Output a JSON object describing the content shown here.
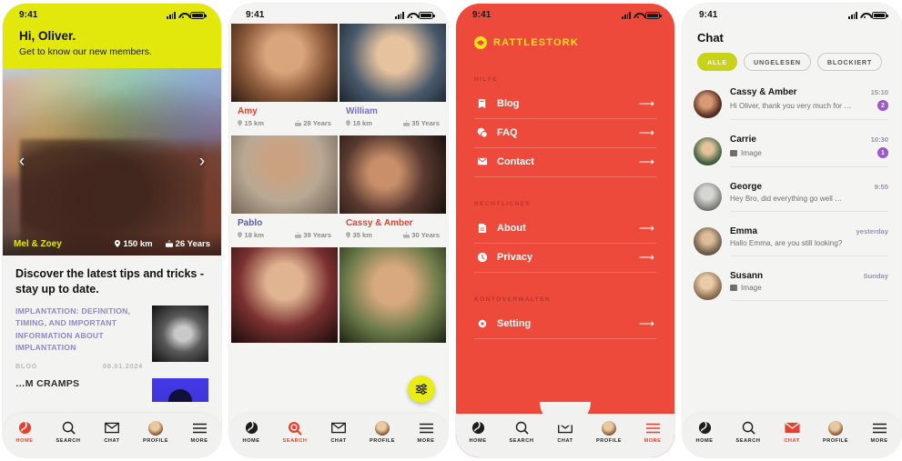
{
  "status_bar": {
    "time": "9:41"
  },
  "nav": {
    "items": [
      {
        "label": "HOME",
        "icon": "globe-icon"
      },
      {
        "label": "SEARCH",
        "icon": "search-icon"
      },
      {
        "label": "CHAT",
        "icon": "envelope-icon"
      },
      {
        "label": "PROFILE",
        "icon": "avatar-icon"
      },
      {
        "label": "MORE",
        "icon": "hamburger-icon"
      }
    ]
  },
  "colors": {
    "brand_red": "#ee4a3c",
    "brand_yellow": "#e3e80c",
    "accent_olive": "#c9d21a",
    "badge_purple": "#9b59c7",
    "blog_purple": "#8f86c9"
  },
  "phone1": {
    "greeting": "Hi, Oliver.",
    "subtitle": "Get to know our new members.",
    "hero": {
      "name": "Mel & Zoey",
      "distance": "150 km",
      "age": "26 Years"
    },
    "carousel": {
      "prev": "‹",
      "next": "›"
    },
    "section_title": "Discover the latest tips and tricks - stay up to date.",
    "blog": {
      "headline": "IMPLANTATION: DEFINITION, TIMING, AND IMPORTANT INFORMATION ABOUT IMPLANTATION",
      "category": "BLOG",
      "date": "08.01.2024"
    },
    "next_article": {
      "headline": "…M CRAMPS"
    },
    "active_nav": "HOME"
  },
  "phone2": {
    "members": [
      {
        "name": "Amy",
        "distance": "15 km",
        "age": "28 Years",
        "name_color": "#e8402f"
      },
      {
        "name": "William",
        "distance": "18 km",
        "age": "35 Years",
        "name_color": "#7a6fc4"
      },
      {
        "name": "Pablo",
        "distance": "18 km",
        "age": "39 Years",
        "name_color": "#5b5ab0"
      },
      {
        "name": "Cassy & Amber",
        "distance": "35 km",
        "age": "30 Years",
        "name_color": "#e8402f"
      }
    ],
    "filter_button": "filter-sliders-icon",
    "active_nav": "SEARCH"
  },
  "phone3": {
    "brand": "RATTLESTORK",
    "sections": [
      {
        "title": "HILFE",
        "items": [
          {
            "label": "Blog",
            "icon": "blog-icon",
            "arrow": "⟶"
          },
          {
            "label": "FAQ",
            "icon": "faq-icon",
            "arrow": "⟶"
          },
          {
            "label": "Contact",
            "icon": "contact-icon",
            "arrow": "⟶"
          }
        ]
      },
      {
        "title": "RECHTLICHES",
        "items": [
          {
            "label": "About",
            "icon": "document-icon",
            "arrow": "⟶"
          },
          {
            "label": "Privacy",
            "icon": "shield-icon",
            "arrow": "⟶"
          }
        ]
      },
      {
        "title": "KONTOVERWALTEN",
        "items": [
          {
            "label": "Setting",
            "icon": "gear-icon",
            "arrow": "⟶"
          }
        ]
      }
    ],
    "active_nav": "MORE"
  },
  "phone4": {
    "title": "Chat",
    "filters": [
      {
        "label": "ALLE",
        "active": true
      },
      {
        "label": "UNGELESEN",
        "active": false
      },
      {
        "label": "BLOCKIERT",
        "active": false
      }
    ],
    "conversations": [
      {
        "name": "Cassy & Amber",
        "time": "15:10",
        "preview": "Hi Oliver, thank you very much for …",
        "unread": "2",
        "is_image": false
      },
      {
        "name": "Carrie",
        "time": "10:30",
        "preview": "Image",
        "unread": "1",
        "is_image": true
      },
      {
        "name": "George",
        "time": "9:55",
        "preview": "Hey Bro, did everything go well …",
        "unread": "",
        "is_image": false
      },
      {
        "name": "Emma",
        "time": "yesterday",
        "preview": "Hallo Emma, are you still looking?",
        "unread": "",
        "is_image": false
      },
      {
        "name": "Susann",
        "time": "Sunday",
        "preview": "Image",
        "unread": "",
        "is_image": true
      }
    ],
    "active_nav": "CHAT"
  }
}
